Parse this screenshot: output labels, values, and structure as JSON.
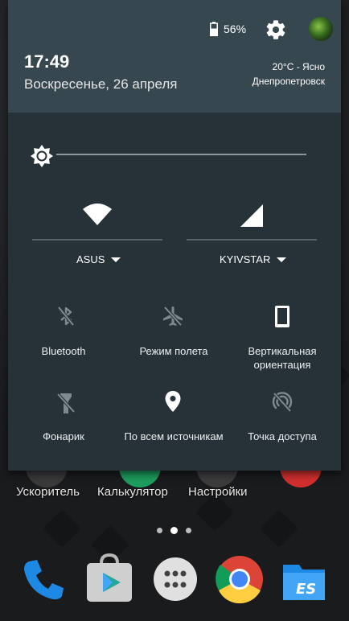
{
  "status": {
    "battery_percent": "56%",
    "battery_icon": "battery-icon",
    "settings_icon": "gear-icon"
  },
  "header": {
    "time": "17:49",
    "date": "Воскресенье, 26 апреля",
    "weather": "20°C - Ясно",
    "city": "Днепропетровск"
  },
  "brightness": {
    "icon": "brightness-icon",
    "level": 0.0
  },
  "network": {
    "wifi": {
      "icon": "wifi-icon",
      "label": "ASUS"
    },
    "cellular": {
      "icon": "cellular-signal-icon",
      "label": "KYIVSTAR"
    }
  },
  "tiles": [
    {
      "label": "Bluetooth",
      "icon": "bluetooth-off-icon",
      "active": false
    },
    {
      "label": "Режим полета",
      "icon": "airplane-icon",
      "active": false
    },
    {
      "label": "Вертикальная ориентация",
      "icon": "portrait-orientation-icon",
      "active": true
    },
    {
      "label": "Фонарик",
      "icon": "flashlight-off-icon",
      "active": false
    },
    {
      "label": "По всем источникам",
      "icon": "location-pin-icon",
      "active": true
    },
    {
      "label": "Точка доступа",
      "icon": "hotspot-off-icon",
      "active": false
    }
  ],
  "home": {
    "app_labels": [
      "Ускоритель",
      "Калькулятор",
      "Настройки"
    ],
    "page_count": 3,
    "active_page": 2,
    "dock": [
      "phone-icon",
      "play-store-icon",
      "app-drawer-icon",
      "chrome-icon",
      "es-file-explorer-icon"
    ]
  },
  "colors": {
    "shade_bg": "#263238",
    "header_bg": "#37474f",
    "inactive_icon": "#7e8a90",
    "active_icon": "#ffffff"
  }
}
